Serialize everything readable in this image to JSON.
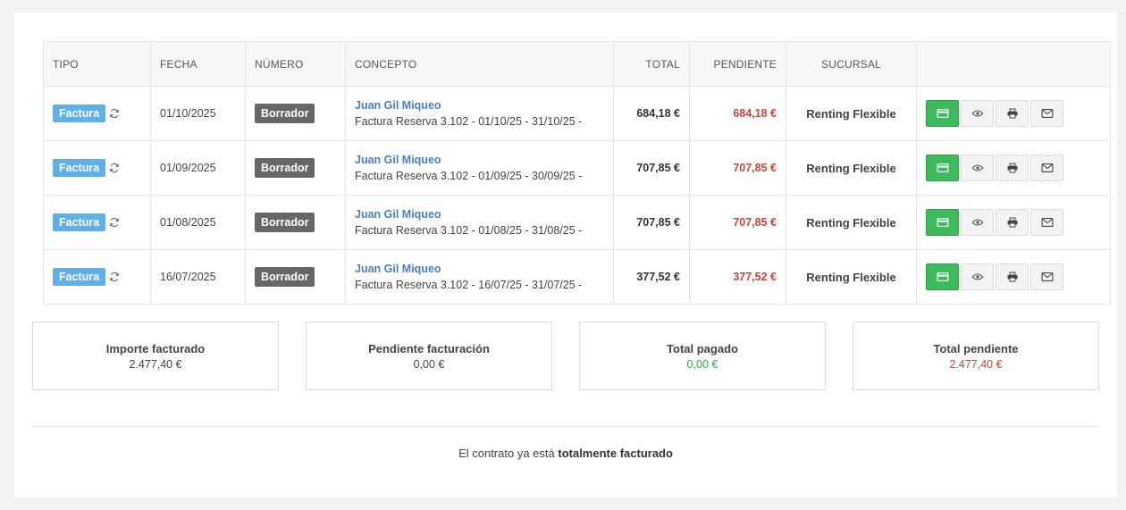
{
  "table": {
    "headers": {
      "tipo": "TIPO",
      "fecha": "FECHA",
      "numero": "NÚMERO",
      "concepto": "CONCEPTO",
      "total": "TOTAL",
      "pendiente": "PENDIENTE",
      "sucursal": "SUCURSAL",
      "acciones": ""
    },
    "rows": [
      {
        "tipo": "Factura",
        "fecha": "01/10/2025",
        "numero": "Borrador",
        "cliente": "Juan Gil Miqueo",
        "concepto": "Factura Reserva 3.102 - 01/10/25 - 31/10/25 -",
        "total": "684,18 €",
        "pendiente": "684,18 €",
        "sucursal": "Renting Flexible"
      },
      {
        "tipo": "Factura",
        "fecha": "01/09/2025",
        "numero": "Borrador",
        "cliente": "Juan Gil Miqueo",
        "concepto": "Factura Reserva 3.102 - 01/09/25 - 30/09/25 -",
        "total": "707,85 €",
        "pendiente": "707,85 €",
        "sucursal": "Renting Flexible"
      },
      {
        "tipo": "Factura",
        "fecha": "01/08/2025",
        "numero": "Borrador",
        "cliente": "Juan Gil Miqueo",
        "concepto": "Factura Reserva 3.102 - 01/08/25 - 31/08/25 -",
        "total": "707,85 €",
        "pendiente": "707,85 €",
        "sucursal": "Renting Flexible"
      },
      {
        "tipo": "Factura",
        "fecha": "16/07/2025",
        "numero": "Borrador",
        "cliente": "Juan Gil Miqueo",
        "concepto": "Factura Reserva 3.102 - 16/07/25 - 31/07/25 -",
        "total": "377,52 €",
        "pendiente": "377,52 €",
        "sucursal": "Renting Flexible"
      }
    ],
    "action_icons": [
      "credit-card-icon",
      "eye-icon",
      "print-icon",
      "envelope-icon"
    ]
  },
  "summary": [
    {
      "title": "Importe facturado",
      "value": "2.477,40 €",
      "color": "#444444"
    },
    {
      "title": "Pendiente facturación",
      "value": "0,00 €",
      "color": "#444444"
    },
    {
      "title": "Total pagado",
      "value": "0,00 €",
      "color": "#2eaa4e"
    },
    {
      "title": "Total pendiente",
      "value": "2.477,40 €",
      "color": "#c9443a"
    }
  ],
  "footer": {
    "prefix": "El contrato ya está",
    "emphasis": "totalmente facturado"
  },
  "colors": {
    "factura_badge": "#5fb0e8",
    "borrador_badge": "#666666",
    "link": "#4a7fc1",
    "pending": "#c9443a",
    "pay_button": "#3cba5c"
  }
}
